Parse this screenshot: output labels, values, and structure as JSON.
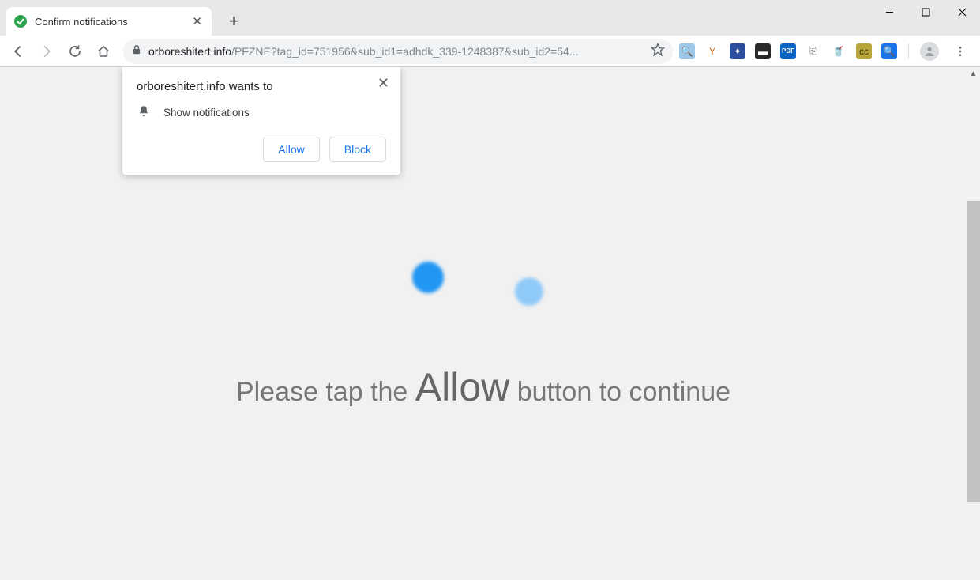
{
  "tab": {
    "title": "Confirm notifications"
  },
  "window_controls": {
    "minimize": "–",
    "maximize": "☐",
    "close": "✕"
  },
  "toolbar": {
    "url_host": "orboreshitert.info",
    "url_path": "/PFZNE?tag_id=751956&sub_id1=adhdk_339-1248387&sub_id2=54..."
  },
  "extensions": [
    {
      "name": "search-ext",
      "bg": "#9cc7e6",
      "fg": "#1a5f9e",
      "glyph": "🔍"
    },
    {
      "name": "hn-ext",
      "bg": "#ffffff",
      "fg": "#e06000",
      "glyph": "Y"
    },
    {
      "name": "blue-ext",
      "bg": "#2b4f9e",
      "fg": "#ffffff",
      "glyph": "✦"
    },
    {
      "name": "display-ext",
      "bg": "#2b2b2b",
      "fg": "#ffffff",
      "glyph": "▬"
    },
    {
      "name": "pdf-ext",
      "bg": "#0b63c4",
      "fg": "#ffffff",
      "glyph": "PDF"
    },
    {
      "name": "copy-ext",
      "bg": "transparent",
      "fg": "#5f6368",
      "glyph": "⎘"
    },
    {
      "name": "bucket-ext",
      "bg": "transparent",
      "fg": "#d13a1e",
      "glyph": "🥤"
    },
    {
      "name": "cc-ext",
      "bg": "#b8a63a",
      "fg": "#3a3a00",
      "glyph": "cc"
    },
    {
      "name": "zoom-ext",
      "bg": "#1a73e8",
      "fg": "#ffffff",
      "glyph": "🔍"
    }
  ],
  "notification": {
    "origin_text": "orboreshitert.info wants to",
    "permission_text": "Show notifications",
    "allow_label": "Allow",
    "block_label": "Block"
  },
  "page": {
    "text_before": "Please tap the ",
    "text_emph": "Allow",
    "text_after": " button to continue"
  }
}
